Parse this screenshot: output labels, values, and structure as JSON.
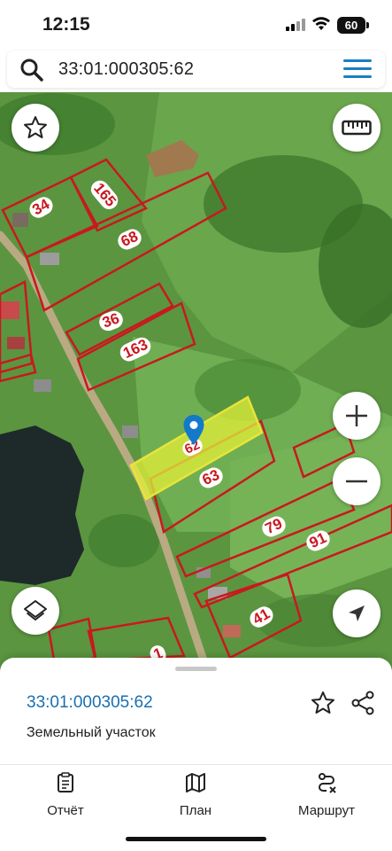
{
  "status_bar": {
    "time": "12:15",
    "battery": "60"
  },
  "search": {
    "query": "33:01:000305:62"
  },
  "map": {
    "parcels": {
      "p34": "34",
      "p165": "165",
      "p68": "68",
      "p36": "36",
      "p163": "163",
      "p62": "62",
      "p63": "63",
      "p79": "79",
      "p91": "91",
      "p41": "41",
      "p1x": "1"
    },
    "colors": {
      "parcel_border": "#c8191e",
      "selected_fill": "#e3ef3a",
      "pin": "#1479c9",
      "label_bg": "#ffffff"
    }
  },
  "sheet": {
    "parcel_number": "33:01:000305:62",
    "parcel_type": "Земельный участок"
  },
  "tabs": [
    {
      "label": "Отчёт",
      "icon": "report-icon"
    },
    {
      "label": "План",
      "icon": "map-plan-icon"
    },
    {
      "label": "Маршрут",
      "icon": "route-icon"
    }
  ]
}
